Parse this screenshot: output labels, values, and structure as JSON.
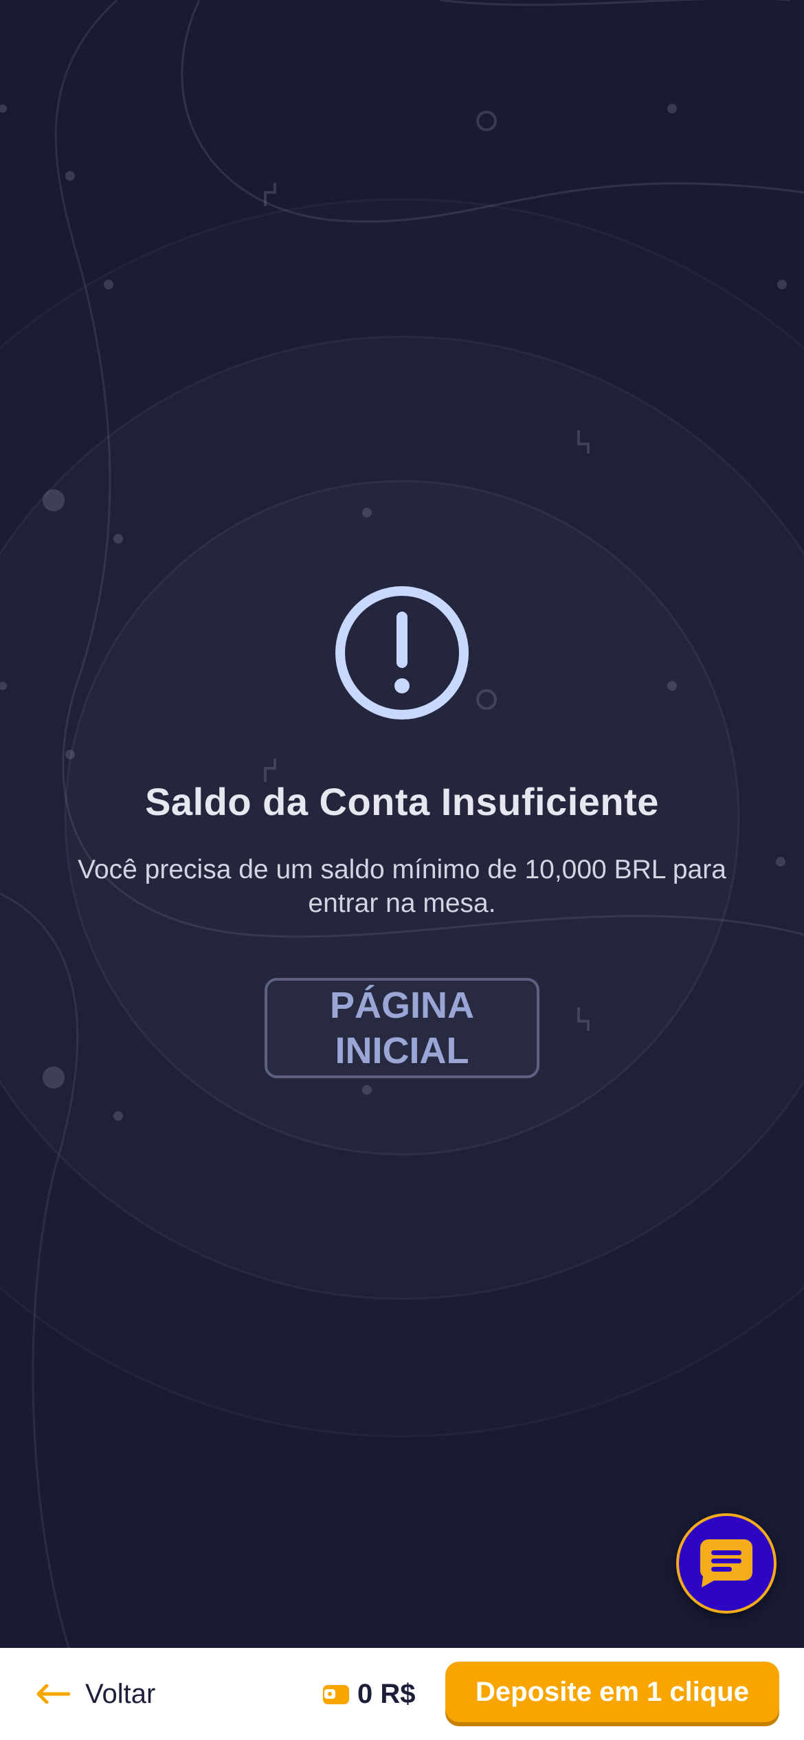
{
  "alert": {
    "icon": "exclamation-circle-icon",
    "title": "Saldo da Conta Insuficiente",
    "message": "Você precisa de um saldo mínimo de 10,000 BRL para entrar na mesa.",
    "home_button": "PÁGINA INICIAL"
  },
  "chat": {
    "icon": "chat-bubble-icon"
  },
  "bottom_bar": {
    "back_label": "Voltar",
    "back_icon": "arrow-left-icon",
    "wallet_icon": "wallet-icon",
    "balance": "0 R$",
    "deposit_label": "Deposite em 1 clique"
  },
  "colors": {
    "background": "#191b35",
    "accent": "#f8a500",
    "chat_fab": "#2d06c4",
    "icon": "#c9d8ff"
  }
}
